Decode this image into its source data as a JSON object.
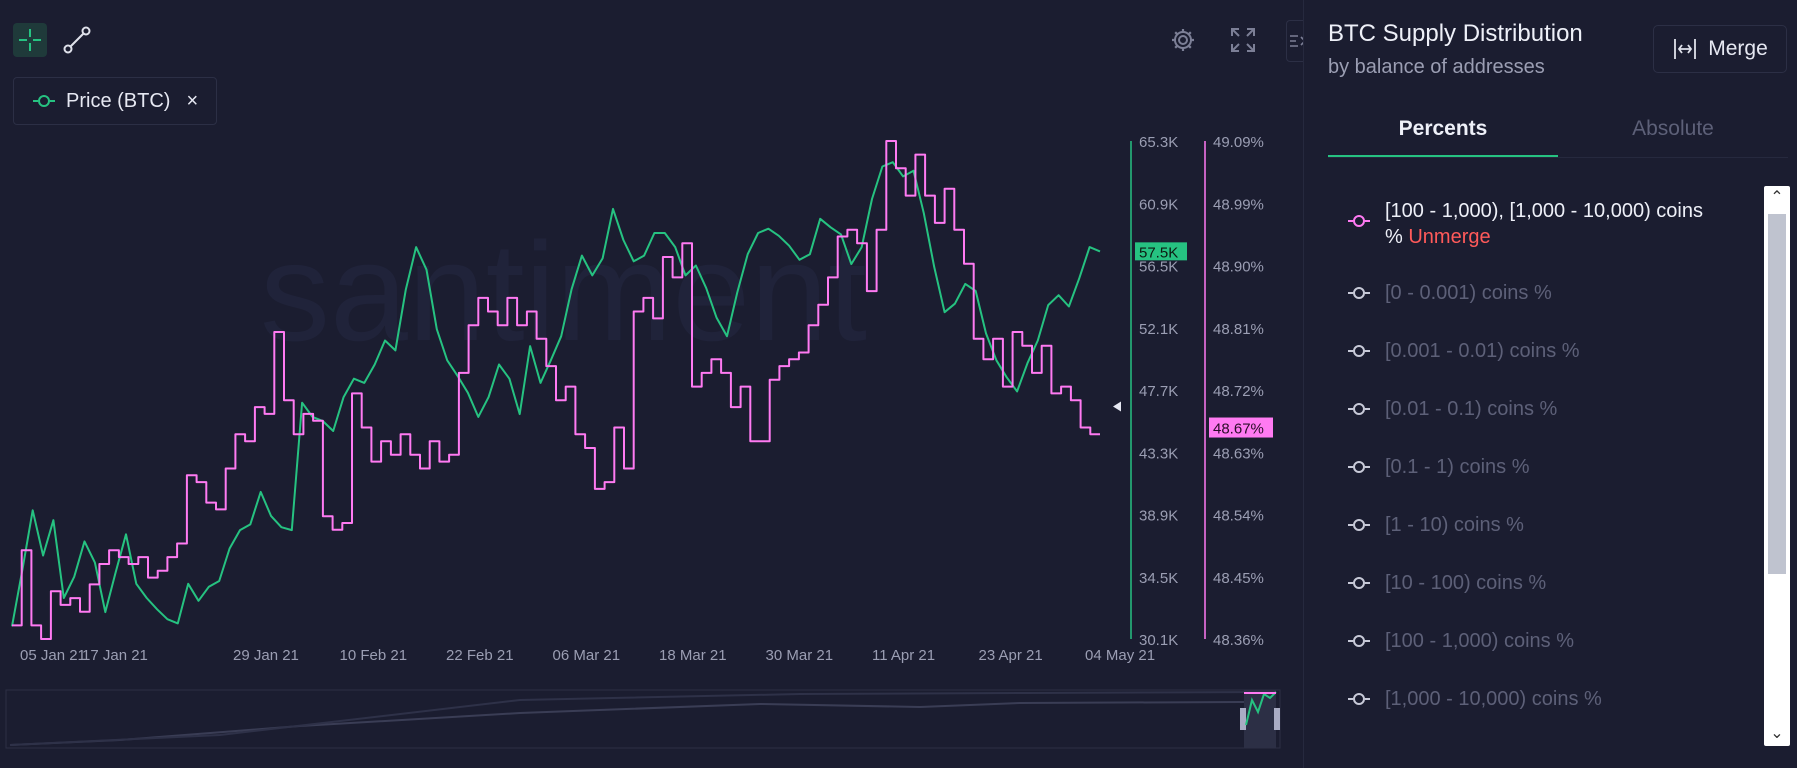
{
  "toolbar": {
    "tools": [
      {
        "name": "crosshair-icon",
        "active": true
      },
      {
        "name": "line-draw-icon",
        "active": false
      }
    ],
    "right_icons": [
      "gear-icon",
      "fullscreen-icon",
      "collapse-sidebar-icon"
    ]
  },
  "metric_chip": {
    "label": "Price (BTC)",
    "close": "×",
    "color": "#26c281"
  },
  "watermark": "santiment",
  "chart_data": {
    "type": "line",
    "x_labels": [
      "05 Jan 21",
      "17 Jan 21",
      "29 Jan 21",
      "10 Feb 21",
      "22 Feb 21",
      "06 Mar 21",
      "18 Mar 21",
      "30 Mar 21",
      "11 Apr 21",
      "23 Apr 21",
      "04 May 21"
    ],
    "axes": {
      "price": {
        "ticks": [
          "65.3K",
          "60.9K",
          "56.5K",
          "52.1K",
          "47.7K",
          "43.3K",
          "38.9K",
          "34.5K",
          "30.1K"
        ],
        "range": [
          30100,
          65300
        ],
        "current_label": "57.5K",
        "current_value": 57500,
        "color": "#26c281"
      },
      "percent": {
        "ticks": [
          "49.09%",
          "48.99%",
          "48.90%",
          "48.81%",
          "48.72%",
          "48.63%",
          "48.54%",
          "48.45%",
          "48.36%"
        ],
        "range": [
          48.36,
          49.09
        ],
        "current_label": "48.67%",
        "current_value": 48.67,
        "color": "#ff7af2"
      }
    },
    "series": [
      {
        "name": "Price (BTC)",
        "axis": "price",
        "color": "#26c281",
        "values": [
          31000,
          35000,
          39200,
          36000,
          38500,
          33000,
          34500,
          37000,
          35500,
          32000,
          34800,
          37500,
          34000,
          33000,
          32200,
          31500,
          31200,
          34000,
          32800,
          33800,
          34200,
          36500,
          37800,
          38200,
          40500,
          38800,
          38000,
          37800,
          46800,
          45800,
          45500,
          44800,
          47200,
          48500,
          48200,
          49500,
          51200,
          50500,
          54800,
          57800,
          56200,
          52000,
          49800,
          48700,
          47500,
          45800,
          47200,
          49500,
          48500,
          46000,
          50800,
          48200,
          49800,
          51500,
          54800,
          57200,
          55800,
          57000,
          60500,
          58300,
          56800,
          57200,
          58800,
          58800,
          57800,
          55800,
          56500,
          54900,
          52800,
          51500,
          54600,
          57300,
          58800,
          59100,
          58600,
          57900,
          56900,
          57300,
          59800,
          59200,
          58700,
          56600,
          57800,
          61200,
          63500,
          63800,
          62800,
          63200,
          60200,
          56400,
          53200,
          53800,
          55200,
          54700,
          51700,
          49800,
          48600,
          47600,
          49600,
          51200,
          53700,
          54400,
          53600,
          55600,
          57800,
          57500
        ]
      },
      {
        "name": "[100 - 1,000), [1,000 - 10,000) coins %",
        "axis": "percent",
        "color": "#ff7af2",
        "values": [
          48.38,
          48.49,
          48.38,
          48.36,
          48.43,
          48.41,
          48.42,
          48.4,
          48.44,
          48.47,
          48.49,
          48.48,
          48.47,
          48.48,
          48.45,
          48.46,
          48.48,
          48.5,
          48.6,
          48.59,
          48.56,
          48.55,
          48.61,
          48.66,
          48.65,
          48.7,
          48.69,
          48.81,
          48.71,
          48.66,
          48.69,
          48.68,
          48.54,
          48.52,
          48.53,
          48.72,
          48.67,
          48.62,
          48.65,
          48.63,
          48.66,
          48.63,
          48.61,
          48.65,
          48.62,
          48.63,
          48.75,
          48.82,
          48.86,
          48.84,
          48.82,
          48.86,
          48.82,
          48.84,
          48.8,
          48.76,
          48.71,
          48.73,
          48.66,
          48.64,
          48.58,
          48.59,
          48.67,
          48.61,
          48.84,
          48.86,
          48.83,
          48.92,
          48.89,
          48.94,
          48.73,
          48.75,
          48.77,
          48.75,
          48.7,
          48.73,
          48.65,
          48.65,
          48.74,
          48.76,
          48.77,
          48.78,
          48.82,
          48.85,
          48.89,
          48.95,
          48.96,
          48.94,
          48.87,
          48.96,
          49.09,
          49.05,
          49.01,
          49.07,
          49.01,
          48.97,
          49.02,
          48.96,
          48.91,
          48.8,
          48.77,
          48.8,
          48.73,
          48.81,
          48.79,
          48.75,
          48.79,
          48.72,
          48.73,
          48.71,
          48.67,
          48.66,
          48.66
        ]
      }
    ],
    "grid": false,
    "legend": "top-left"
  },
  "panel": {
    "title": "BTC Supply Distribution",
    "subtitle": "by balance of addresses",
    "merge_label": "Merge",
    "tabs": [
      "Percents",
      "Absolute"
    ],
    "active_tab": "Percents",
    "items": [
      {
        "label": "[100 - 1,000), [1,000 - 10,000) coins %",
        "action": "Unmerge",
        "active": true
      },
      {
        "label": "[0 - 0.001) coins %",
        "active": false
      },
      {
        "label": "[0.001 - 0.01) coins %",
        "active": false
      },
      {
        "label": "[0.01 - 0.1) coins %",
        "active": false
      },
      {
        "label": "[0.1 - 1) coins %",
        "active": false
      },
      {
        "label": "[1 - 10) coins %",
        "active": false
      },
      {
        "label": "[10 - 100) coins %",
        "active": false
      },
      {
        "label": "[100 - 1,000) coins %",
        "active": false
      },
      {
        "label": "[1,000 - 10,000) coins %",
        "active": false
      }
    ]
  }
}
